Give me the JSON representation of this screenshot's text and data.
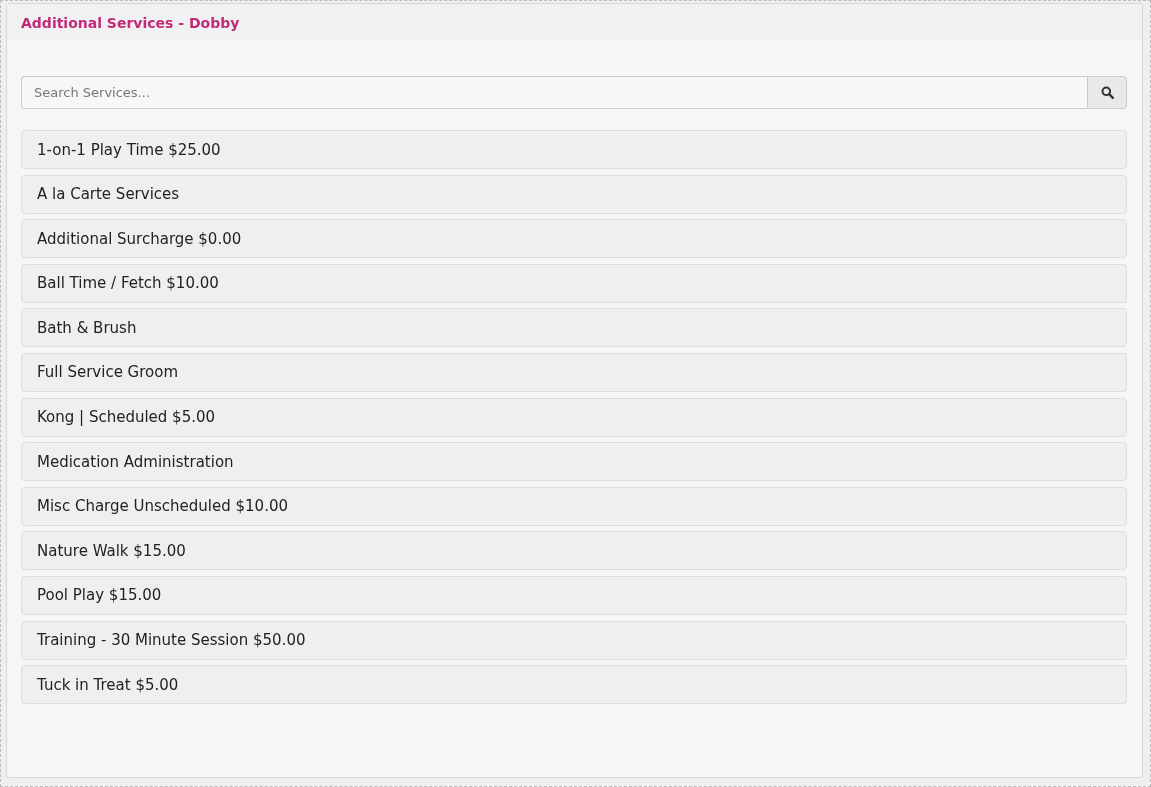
{
  "panel": {
    "title": "Additional Services - Dobby"
  },
  "search": {
    "placeholder": "Search Services..."
  },
  "services": [
    {
      "label": "1-on-1 Play Time $25.00"
    },
    {
      "label": "A la Carte Services"
    },
    {
      "label": "Additional Surcharge $0.00"
    },
    {
      "label": "Ball Time / Fetch $10.00"
    },
    {
      "label": "Bath & Brush"
    },
    {
      "label": "Full Service Groom"
    },
    {
      "label": "Kong | Scheduled $5.00"
    },
    {
      "label": "Medication Administration"
    },
    {
      "label": "Misc Charge Unscheduled $10.00"
    },
    {
      "label": "Nature Walk $15.00"
    },
    {
      "label": "Pool Play $15.00"
    },
    {
      "label": "Training - 30 Minute Session $50.00"
    },
    {
      "label": "Tuck in Treat $5.00"
    }
  ]
}
